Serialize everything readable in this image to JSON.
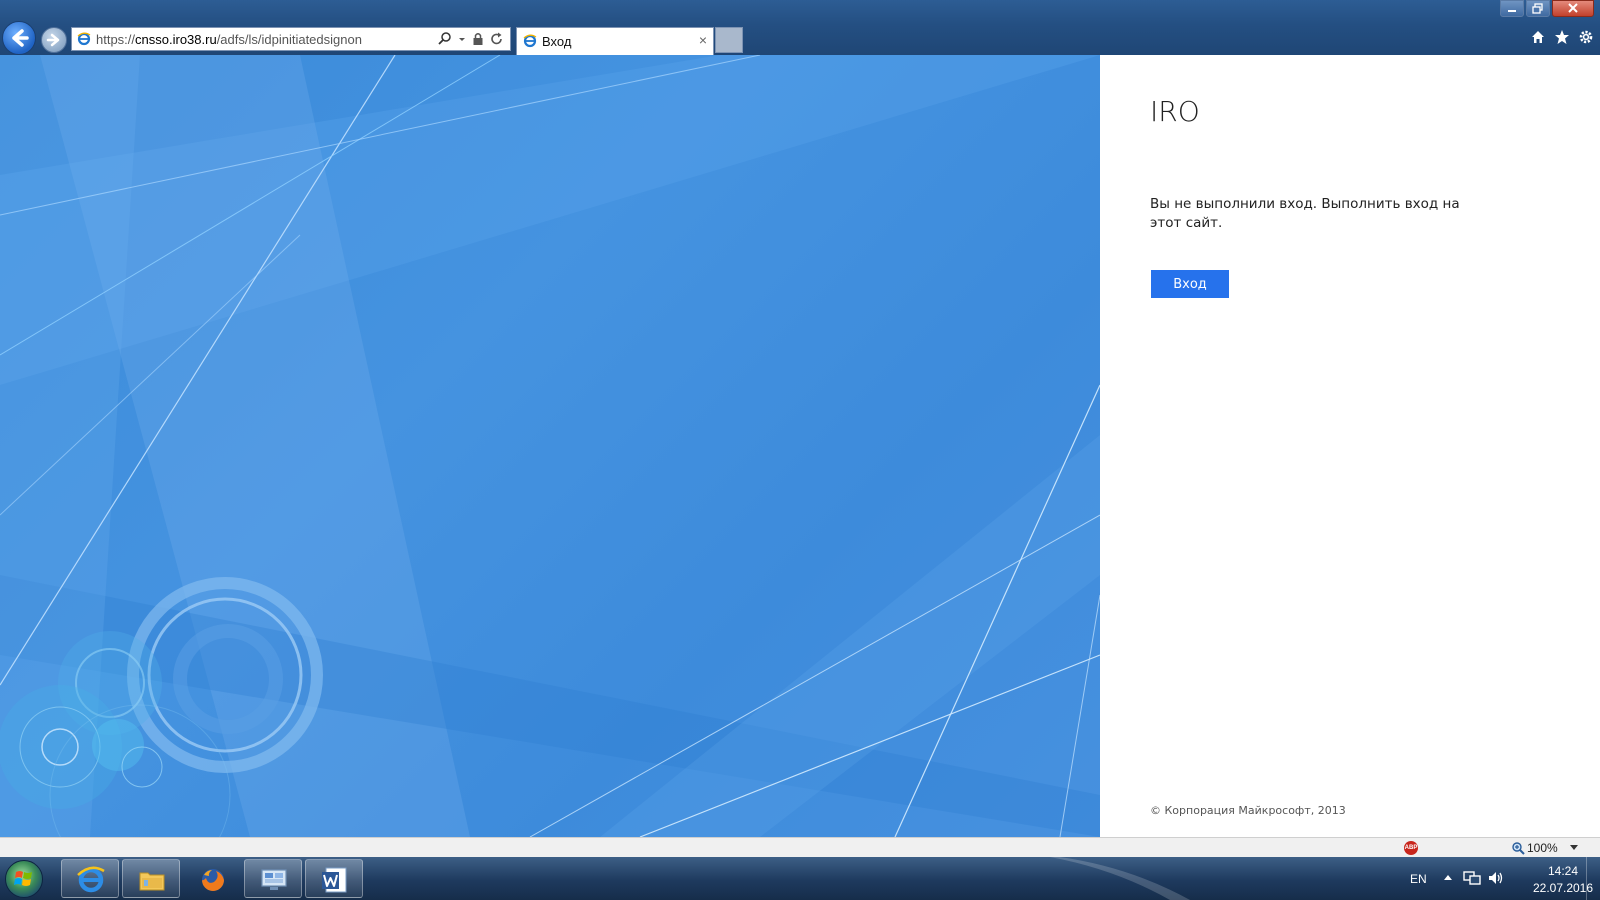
{
  "browser": {
    "address": {
      "scheme": "https://",
      "host": "cnsso.iro38.ru",
      "path": "/adfs/ls/idpinitiatedsignon"
    },
    "tab": {
      "title": "Вход",
      "close": "×"
    }
  },
  "login": {
    "org_name": "IRO",
    "message": "Вы не выполнили вход. Выполнить вход на этот сайт.",
    "sign_in_button": "Вход",
    "copyright": "© Корпорация Майкрософт, 2013"
  },
  "status_bar": {
    "zoom": "100%",
    "abp_label": "ABP"
  },
  "taskbar": {
    "apps": [
      {
        "icon": "internet-explorer-icon"
      },
      {
        "icon": "file-explorer-icon"
      },
      {
        "icon": "firefox-icon"
      },
      {
        "icon": "remote-desktop-icon"
      },
      {
        "icon": "word-icon"
      }
    ],
    "language": "EN",
    "time": "14:24",
    "date": "22.07.2016"
  },
  "colors": {
    "accent_button": "#2672ec",
    "hero_blue": "#4593e0",
    "taskbar": "#1e3a5e"
  }
}
